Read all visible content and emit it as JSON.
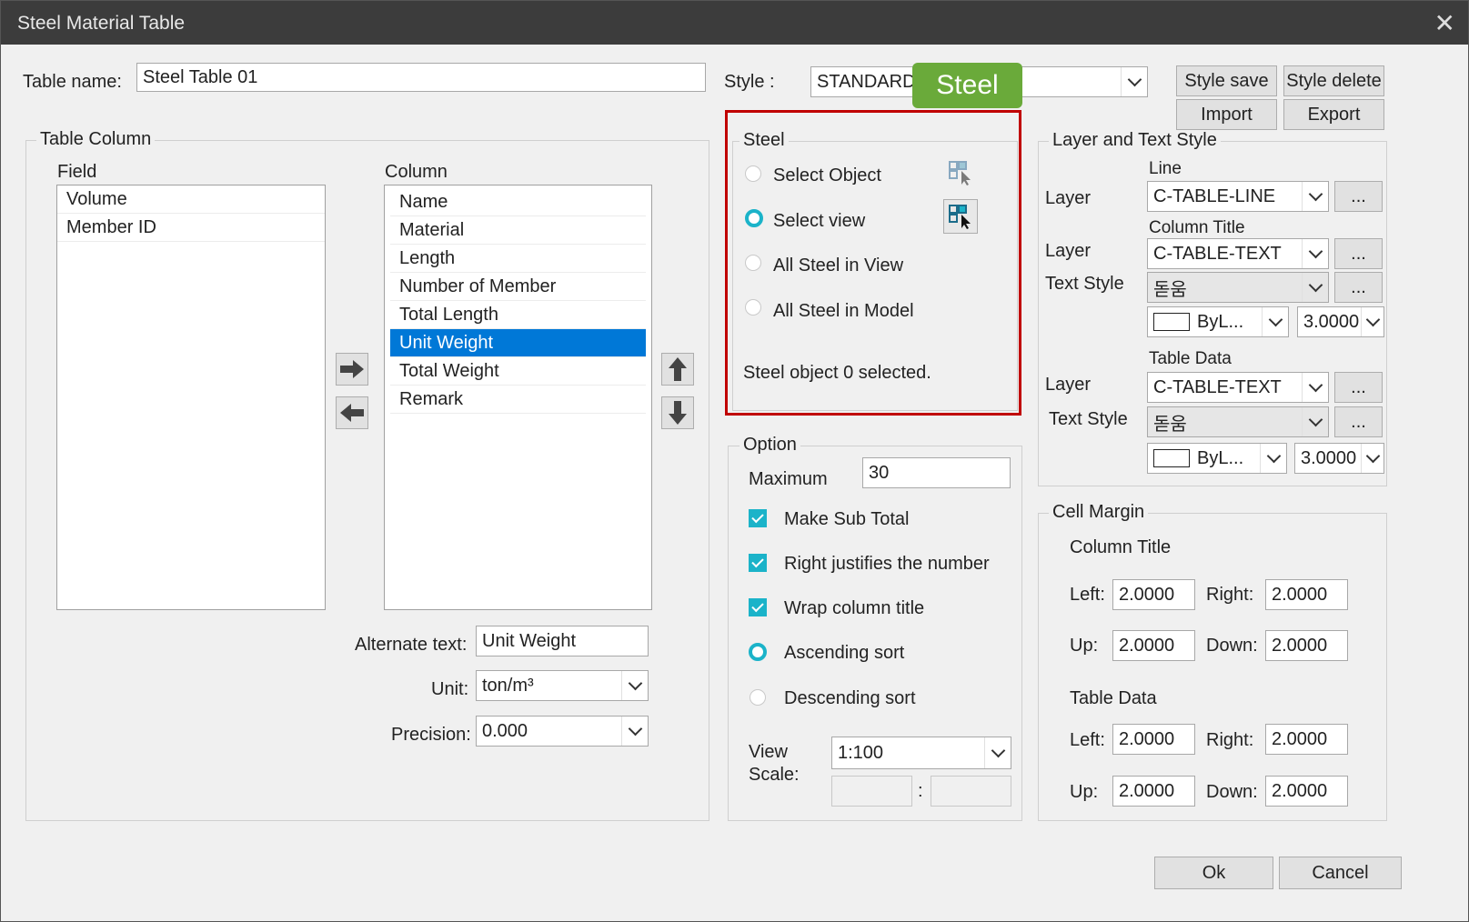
{
  "window": {
    "title": "Steel Material Table",
    "close_glyph": "✕"
  },
  "header": {
    "table_name_label": "Table name:",
    "table_name_value": "Steel Table 01",
    "style_label": "Style :",
    "style_value": "STANDARD_",
    "style_save": "Style save",
    "style_delete": "Style delete",
    "import": "Import",
    "export": "Export"
  },
  "callout": {
    "label": "Steel",
    "color": "#6aaa3a"
  },
  "table_column": {
    "title": "Table Column",
    "field_label": "Field",
    "column_label": "Column",
    "fields": [
      "Volume",
      "Member ID"
    ],
    "columns": [
      "Name",
      "Material",
      "Length",
      "Number of Member",
      "Total Length",
      "Unit Weight",
      "Total Weight",
      "Remark"
    ],
    "selected_column": "Unit Weight",
    "alternate_text_label": "Alternate text:",
    "alternate_text_value": "Unit Weight",
    "unit_label": "Unit:",
    "unit_value": "ton/m³",
    "precision_label": "Precision:",
    "precision_value": "0.000"
  },
  "steel": {
    "title": "Steel",
    "highlight_color": "#c00000",
    "options": [
      {
        "label": "Select Object",
        "checked": false
      },
      {
        "label": "Select view",
        "checked": true
      },
      {
        "label": "All Steel in View",
        "checked": false
      },
      {
        "label": "All Steel in Model",
        "checked": false
      }
    ],
    "status": "Steel object 0 selected."
  },
  "option": {
    "title": "Option",
    "maximum_label": "Maximum",
    "maximum_value": "30",
    "checks": [
      {
        "label": "Make Sub Total",
        "checked": true
      },
      {
        "label": "Right justifies the number",
        "checked": true
      },
      {
        "label": "Wrap column title",
        "checked": true
      }
    ],
    "sorts": [
      {
        "label": "Ascending sort",
        "checked": true
      },
      {
        "label": "Descending sort",
        "checked": false
      }
    ],
    "view_scale_label_1": "View",
    "view_scale_label_2": "Scale:",
    "view_scale_value": "1:100",
    "ratio_separator": ":"
  },
  "layer_text_style": {
    "title": "Layer and Text Style",
    "line_header": "Line",
    "column_title_header": "Column Title",
    "table_data_header": "Table Data",
    "layer_label": "Layer",
    "text_style_label": "Text Style",
    "line_layer": "C-TABLE-LINE",
    "column_title_layer": "C-TABLE-TEXT",
    "column_title_text_style": "돋움",
    "column_title_color": "ByL...",
    "column_title_height": "3.0000",
    "table_data_layer": "C-TABLE-TEXT",
    "table_data_text_style": "돋움",
    "table_data_color": "ByL...",
    "table_data_height": "3.0000",
    "ellipsis": "..."
  },
  "cell_margin": {
    "title": "Cell Margin",
    "column_title_header": "Column Title",
    "table_data_header": "Table Data",
    "left_label": "Left:",
    "right_label": "Right:",
    "up_label": "Up:",
    "down_label": "Down:",
    "column_title": {
      "left": "2.0000",
      "right": "2.0000",
      "up": "2.0000",
      "down": "2.0000"
    },
    "table_data": {
      "left": "2.0000",
      "right": "2.0000",
      "up": "2.0000",
      "down": "2.0000"
    }
  },
  "footer": {
    "ok": "Ok",
    "cancel": "Cancel"
  }
}
